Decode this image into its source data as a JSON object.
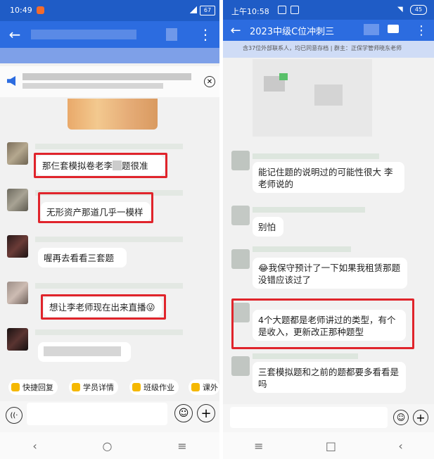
{
  "colors": {
    "accent": "#2c6ce0",
    "highlight_box": "#e0242b"
  },
  "left": {
    "status_time": "10:49",
    "battery": "67",
    "messages": [
      {
        "text": "那仨套模拟卷老李",
        "text_tail": "题很准"
      },
      {
        "text": "无形资产那道几乎一模样"
      },
      {
        "text": "喔再去看看三套题"
      },
      {
        "text": "想让李老师现在出来直播",
        "emoji": "😜"
      }
    ],
    "quick_actions": [
      "快捷回复",
      "学员详情",
      "班级作业",
      "课外"
    ],
    "icons": {
      "back": "arrow-left-icon",
      "more": "more-vertical-icon",
      "speaker": "speaker-icon",
      "close": "close-icon",
      "voice": "voice-icon",
      "emoji": "emoji-icon",
      "add": "add-icon"
    },
    "nav": [
      "‹",
      "○",
      "≡"
    ]
  },
  "right": {
    "status_time": "上午10:58",
    "battery": "45",
    "title": "2023中级C位冲刺三",
    "subtitle": "含37位外部联系人，均已同意存档 | 群主：正保学管师晓东老师",
    "messages": [
      {
        "text": "能记住题的说明过的可能性很大 李老师说的"
      },
      {
        "text": "别怕"
      },
      {
        "text": "我保守预计了一下如果我租赁那题没错应该过了",
        "emoji": "😂"
      },
      {
        "text": "4个大题都是老师讲过的类型，有个是收入，更新改正那种题型"
      },
      {
        "text": "三套模拟题和之前的题都要多看看是吗"
      }
    ],
    "icons": {
      "back": "arrow-left-icon",
      "video": "video-icon",
      "more": "more-vertical-icon",
      "emoji": "emoji-icon",
      "add": "add-icon"
    },
    "nav": [
      "≡",
      "□",
      "‹"
    ]
  }
}
